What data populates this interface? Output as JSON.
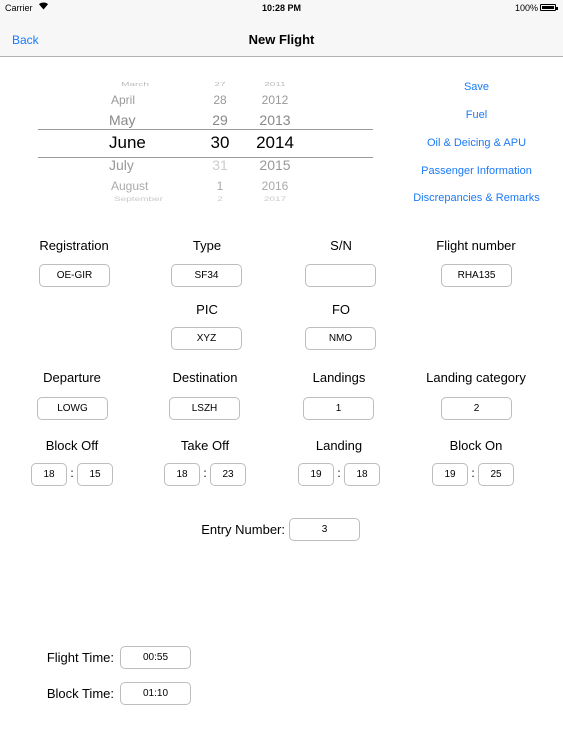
{
  "status_bar": {
    "carrier": "Carrier",
    "time": "10:28 PM",
    "battery": "100%",
    "icons": [
      "wifi-icon",
      "battery-icon"
    ]
  },
  "nav": {
    "back_label": "Back",
    "title": "New Flight"
  },
  "date_picker": {
    "months": [
      "March",
      "April",
      "May",
      "June",
      "July",
      "August",
      "September"
    ],
    "days": [
      "27",
      "28",
      "29",
      "30",
      "31",
      "1",
      "2"
    ],
    "years": [
      "2011",
      "2012",
      "2013",
      "2014",
      "2015",
      "2016",
      "2017"
    ],
    "selected": {
      "month": "June",
      "day": "30",
      "year": "2014"
    }
  },
  "actions": [
    "Save",
    "Fuel",
    "Oil & Deicing & APU",
    "Passenger Information",
    "Discrepancies & Remarks"
  ],
  "form": {
    "registration": {
      "label": "Registration",
      "value": "OE-GIR"
    },
    "type": {
      "label": "Type",
      "value": "SF34"
    },
    "sn": {
      "label": "S/N",
      "value": ""
    },
    "flight_number": {
      "label": "Flight number",
      "value": "RHA135"
    },
    "pic": {
      "label": "PIC",
      "value": "XYZ"
    },
    "fo": {
      "label": "FO",
      "value": "NMO"
    },
    "departure": {
      "label": "Departure",
      "value": "LOWG"
    },
    "destination": {
      "label": "Destination",
      "value": "LSZH"
    },
    "landings": {
      "label": "Landings",
      "value": "1"
    },
    "landing_category": {
      "label": "Landing category",
      "value": "2"
    },
    "block_off": {
      "label": "Block Off",
      "hour": "18",
      "minute": "15"
    },
    "take_off": {
      "label": "Take Off",
      "hour": "18",
      "minute": "23"
    },
    "landing": {
      "label": "Landing",
      "hour": "19",
      "minute": "18"
    },
    "block_on": {
      "label": "Block On",
      "hour": "19",
      "minute": "25"
    },
    "time_separator": ":",
    "entry_number": {
      "label": "Entry Number:",
      "value": "3"
    },
    "flight_time": {
      "label": "Flight Time:",
      "value": "00:55"
    },
    "block_time": {
      "label": "Block Time:",
      "value": "01:10"
    }
  },
  "colors": {
    "accent": "#1a7af8",
    "bar": "#f7f7f7",
    "border": "#bdbdbd"
  }
}
